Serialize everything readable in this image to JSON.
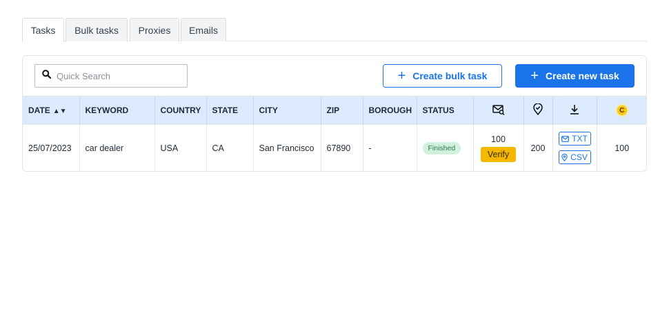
{
  "tabs": [
    {
      "label": "Tasks",
      "active": true
    },
    {
      "label": "Bulk tasks",
      "active": false
    },
    {
      "label": "Proxies",
      "active": false
    },
    {
      "label": "Emails",
      "active": false
    }
  ],
  "toolbar": {
    "search_placeholder": "Quick Search",
    "create_bulk_label": "Create bulk task",
    "create_new_label": "Create new task"
  },
  "table": {
    "headers": {
      "date": "DATE",
      "keyword": "KEYWORD",
      "country": "COUNTRY",
      "state": "STATE",
      "city": "CITY",
      "zip": "ZIP",
      "borough": "BOROUGH",
      "status": "STATUS",
      "coin": "C"
    },
    "header_icons": [
      "email-search-icon",
      "location-check-icon",
      "download-icon",
      "coin-icon"
    ],
    "rows": [
      {
        "date": "25/07/2023",
        "keyword": "car dealer",
        "country": "USA",
        "state": "CA",
        "city": "San Francisco",
        "zip": "67890",
        "borough": "-",
        "status": "Finished",
        "emails": "100",
        "verify_label": "Verify",
        "locations": "200",
        "txt_label": "TXT",
        "csv_label": "CSV",
        "credits": "100"
      }
    ]
  },
  "colors": {
    "accent": "#1a73e8",
    "header_bg": "#dbeafd",
    "verify": "#f5b800",
    "status_finished_bg": "#d1f0dd"
  }
}
